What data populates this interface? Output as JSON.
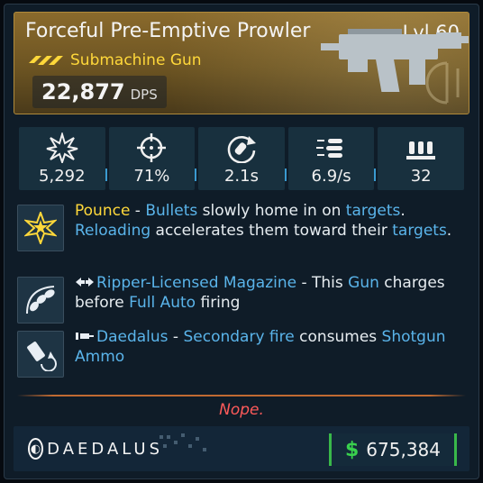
{
  "item": {
    "name": "Forceful Pre-Emptive Prowler",
    "level": "Lvl 60",
    "type": "Submachine Gun",
    "dps_value": "22,877",
    "dps_unit": "DPS"
  },
  "stats": [
    {
      "icon": "damage-burst-icon",
      "value": "5,292"
    },
    {
      "icon": "crosshair-icon",
      "value": "71%"
    },
    {
      "icon": "reload-icon",
      "value": "2.1s"
    },
    {
      "icon": "fire-rate-icon",
      "value": "6.9/s"
    },
    {
      "icon": "magazine-icon",
      "value": "32"
    }
  ],
  "perks": [
    {
      "icon": "star-burst-icon",
      "name": "Pounce",
      "parts": [
        " - ",
        "Bullets",
        " slowly home in on ",
        "targets",
        ". ",
        "Reloading",
        " accelerates them toward their ",
        "targets",
        "."
      ]
    },
    {
      "icon": "bullets-icon",
      "name": "Ripper-Licensed Magazine",
      "parts": [
        " - This ",
        "Gun",
        " charges before ",
        "Full Auto",
        " firing"
      ]
    },
    {
      "icon": "shotgun-shell-icon",
      "name": "Daedalus",
      "parts": [
        " - ",
        "Secondary fire",
        " consumes ",
        "Shotgun Ammo",
        ""
      ]
    }
  ],
  "note": "Nope.",
  "footer": {
    "brand": "DAEDALUS",
    "currency_symbol": "$",
    "price": "675,384"
  },
  "colors": {
    "rarity_gold": "#ffd83a",
    "keyword_blue": "#5ab4ea",
    "note_red": "#ff5a5a",
    "price_green": "#39d04e"
  }
}
